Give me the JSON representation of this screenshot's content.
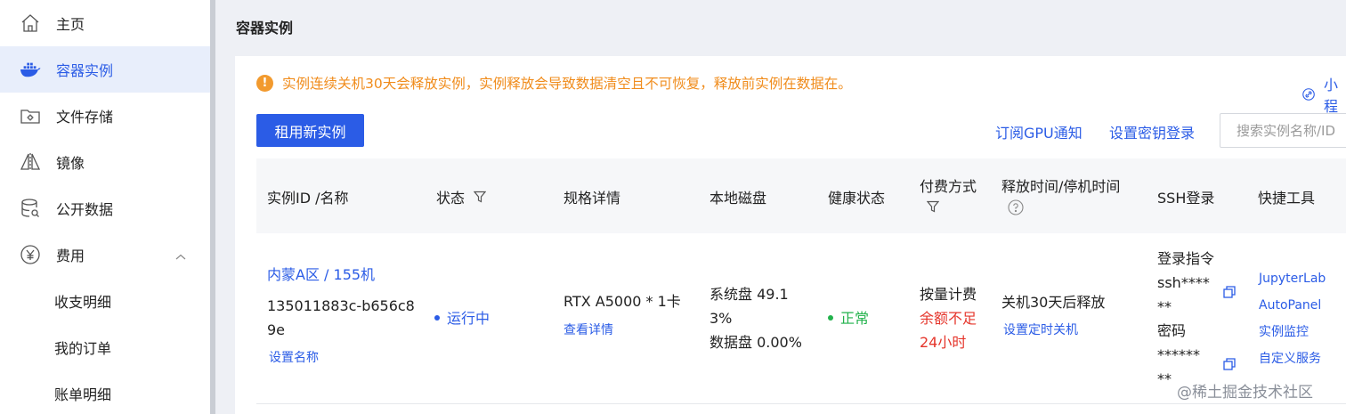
{
  "sidebar": {
    "items": [
      {
        "label": "主页",
        "icon": "home-icon"
      },
      {
        "label": "容器实例",
        "icon": "docker-icon",
        "active": true
      },
      {
        "label": "文件存储",
        "icon": "folder-gear-icon"
      },
      {
        "label": "镜像",
        "icon": "mirror-icon"
      },
      {
        "label": "公开数据",
        "icon": "database-icon"
      },
      {
        "label": "费用",
        "icon": "yen-icon"
      },
      {
        "label": "收支明细"
      },
      {
        "label": "我的订单"
      },
      {
        "label": "账单明细"
      }
    ]
  },
  "header": {
    "title": "容器实例"
  },
  "alert": {
    "text": "实例连续关机30天会释放实例，实例释放会导致数据清空且不可恢复，释放前实例在数据在。",
    "mini_link": "小程"
  },
  "toolbar": {
    "rent_button": "租用新实例",
    "gpu_notify": "订阅GPU通知",
    "key_login": "设置密钥登录",
    "search_placeholder": "搜索实例名称/ID"
  },
  "table": {
    "headers": {
      "id_name": "实例ID /名称",
      "status": "状态",
      "spec": "规格详情",
      "disk": "本地磁盘",
      "health": "健康状态",
      "billing": "付费方式",
      "release": "释放时间/停机时间",
      "ssh": "SSH登录",
      "tools": "快捷工具"
    },
    "row": {
      "region": "内蒙A区 / 155机",
      "id_line1": "135011883c-b656c8",
      "id_line2": "9e",
      "set_name": "设置名称",
      "status": "运行中",
      "spec": "RTX A5000 * 1卡",
      "spec_link": "查看详情",
      "disk_line1": "系统盘 49.1",
      "disk_line2": "3%",
      "disk_line3": "数据盘 0.00%",
      "health": "正常",
      "billing": "按量计费",
      "balance_line1": "余额不足",
      "balance_line2": "24小时",
      "release": "关机30天后释放",
      "release_link": "设置定时关机",
      "ssh_cmd_label": "登录指令",
      "ssh_cmd_line1": "ssh****",
      "ssh_cmd_line2": "**",
      "ssh_pwd_label": "密码",
      "ssh_pwd_line1": "******",
      "ssh_pwd_line2": "**",
      "tools": [
        "JupyterLab",
        "AutoPanel",
        "实例监控",
        "自定义服务"
      ]
    }
  },
  "watermark": "@稀土掘金技术社区",
  "colors": {
    "accent": "#2b5ce6",
    "warning": "#f08c1c",
    "danger": "#e5352b",
    "success": "#22b24c"
  }
}
